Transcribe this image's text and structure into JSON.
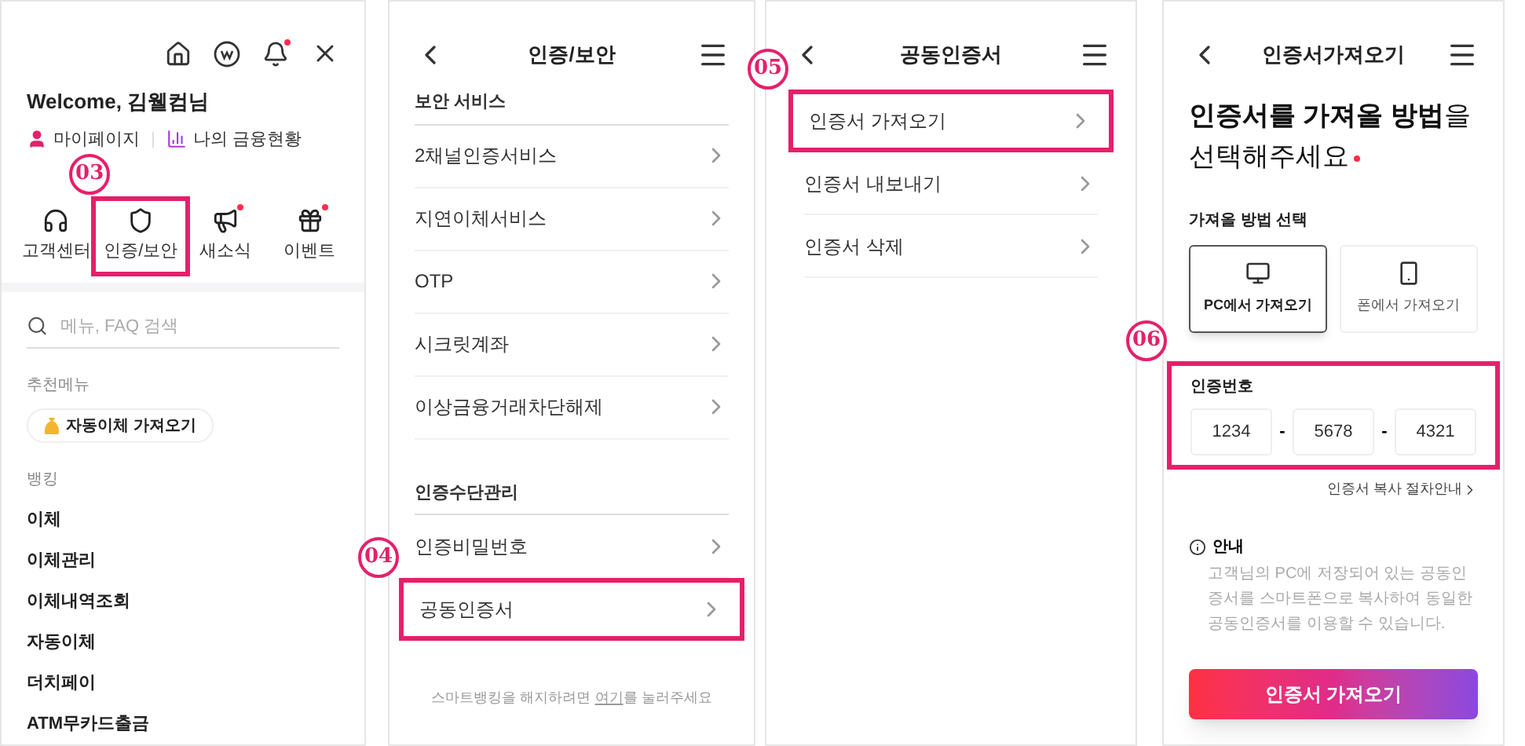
{
  "menu_panel": {
    "greeting": "Welcome, 김웰컴님",
    "links": [
      {
        "label": "마이페이지",
        "kind": "person"
      },
      {
        "label": "나의 금융현황",
        "kind": "chart"
      }
    ],
    "quick_menu": [
      {
        "label": "고객센터",
        "kind": "headset",
        "new": false,
        "highlighted": false
      },
      {
        "label": "인증/보안",
        "kind": "shield",
        "new": false,
        "highlighted": true,
        "callout": "03"
      },
      {
        "label": "새소식",
        "kind": "megaphone",
        "new": true,
        "highlighted": false
      },
      {
        "label": "이벤트",
        "kind": "gift",
        "new": true,
        "highlighted": false
      }
    ],
    "search": {
      "placeholder": "메뉴, FAQ 검색"
    },
    "recommended": {
      "title": "추천메뉴",
      "chip": "자동이체 가져오기"
    },
    "banking": {
      "title": "뱅킹",
      "items": [
        "이체",
        "이체관리",
        "이체내역조회",
        "자동이체",
        "더치페이",
        "ATM무카드출금"
      ]
    }
  },
  "security_panel": {
    "title": "인증/보안",
    "sections": [
      {
        "title": "보안 서비스",
        "items": [
          {
            "label": "2채널인증서비스",
            "highlighted": false
          },
          {
            "label": "지연이체서비스",
            "highlighted": false
          },
          {
            "label": "OTP",
            "highlighted": false
          },
          {
            "label": "시크릿계좌",
            "highlighted": false
          },
          {
            "label": "이상금융거래차단해제",
            "highlighted": false
          }
        ]
      },
      {
        "title": "인증수단관리",
        "items": [
          {
            "label": "인증비밀번호",
            "highlighted": false
          },
          {
            "label": "공동인증서",
            "highlighted": true,
            "callout": "04"
          }
        ]
      }
    ],
    "footer": {
      "before": "스마트뱅킹을 해지하려면",
      "link": "여기",
      "after": "를 눌러주세요"
    }
  },
  "certificate_panel": {
    "title": "공동인증서",
    "items": [
      {
        "label": "인증서 가져오기",
        "highlighted": true,
        "callout": "05"
      },
      {
        "label": "인증서 내보내기",
        "highlighted": false
      },
      {
        "label": "인증서 삭제",
        "highlighted": false
      }
    ]
  },
  "import_panel": {
    "title": "인증서가져오기",
    "heading": [
      "**인증서를 가져올 방법**을",
      "선택해주세요"
    ],
    "method_label": "가져올 방법 선택",
    "methods": [
      {
        "label": "PC에서 가져오기",
        "kind": "pc",
        "selected": true
      },
      {
        "label": "폰에서 가져오기",
        "kind": "phone",
        "selected": false
      }
    ],
    "code": {
      "label": "인증번호",
      "highlighted": true,
      "callout": "06",
      "values": [
        "1234",
        "5678",
        "4321"
      ],
      "separators": [
        "-",
        "-"
      ]
    },
    "guide_link": "인증서 복사 절차안내",
    "notice": {
      "title": "안내",
      "text": "고객님의 PC에 저장되어 있는 공동인증서를 스마트폰으로 복사하여 동일한 공동인증서를 이용할 수 있습니다."
    },
    "button": "인증서 가져오기"
  }
}
